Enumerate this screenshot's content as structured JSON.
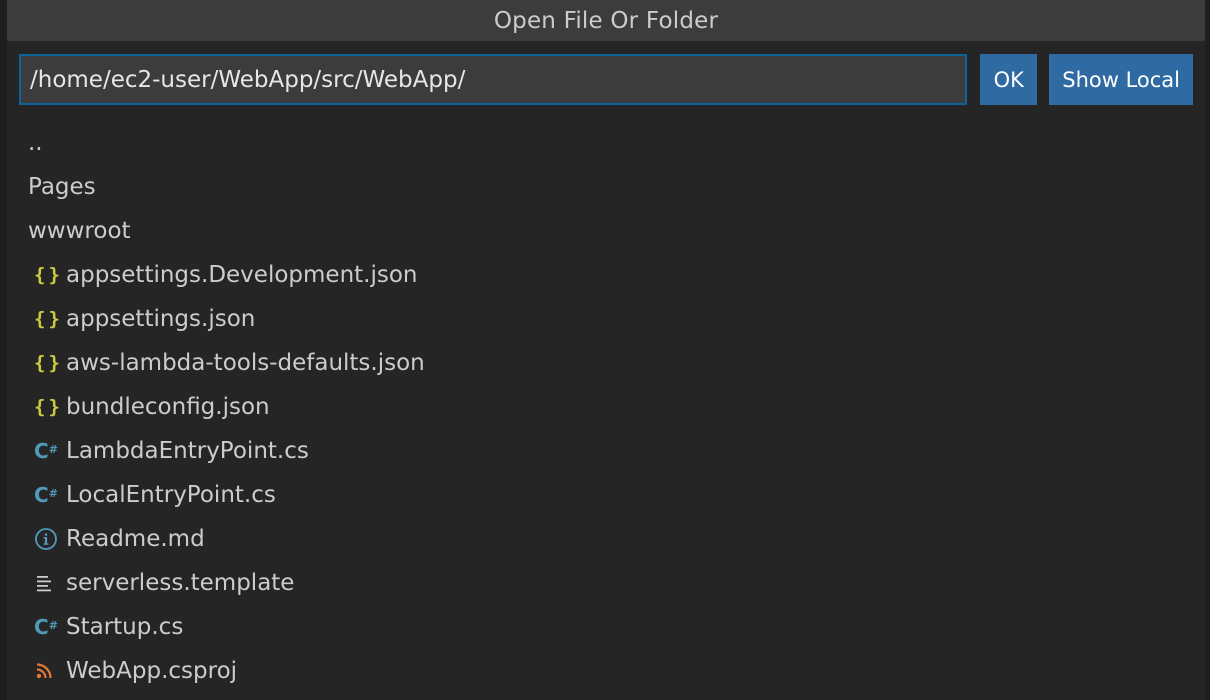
{
  "dialog": {
    "title": "Open File Or Folder",
    "path_value": "/home/ec2-user/WebApp/src/WebApp/",
    "ok_label": "OK",
    "show_local_label": "Show Local"
  },
  "items": [
    {
      "label": "..",
      "icon": "none"
    },
    {
      "label": "Pages",
      "icon": "none"
    },
    {
      "label": "wwwroot",
      "icon": "none"
    },
    {
      "label": "appsettings.Development.json",
      "icon": "json-icon"
    },
    {
      "label": "appsettings.json",
      "icon": "json-icon"
    },
    {
      "label": "aws-lambda-tools-defaults.json",
      "icon": "json-icon"
    },
    {
      "label": "bundleconfig.json",
      "icon": "json-icon"
    },
    {
      "label": "LambdaEntryPoint.cs",
      "icon": "csharp-icon"
    },
    {
      "label": "LocalEntryPoint.cs",
      "icon": "csharp-icon"
    },
    {
      "label": "Readme.md",
      "icon": "info-icon"
    },
    {
      "label": "serverless.template",
      "icon": "text-lines-icon"
    },
    {
      "label": "Startup.cs",
      "icon": "csharp-icon"
    },
    {
      "label": "WebApp.csproj",
      "icon": "rss-icon"
    }
  ],
  "colors": {
    "accent": "#2f6aa3",
    "json_icon": "#cbcb41",
    "csharp_icon": "#519aba",
    "rss_icon": "#e37933"
  }
}
